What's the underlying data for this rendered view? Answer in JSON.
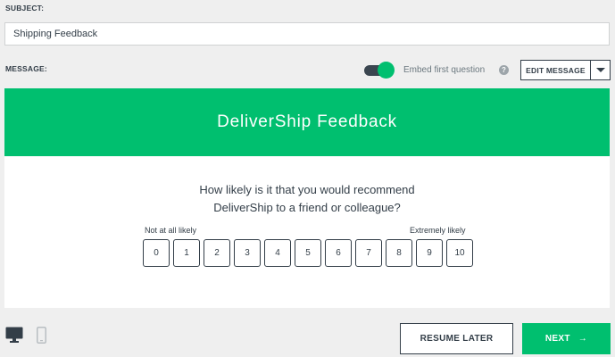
{
  "subject": {
    "label": "SUBJECT:",
    "value": "Shipping Feedback"
  },
  "message": {
    "label": "MESSAGE:",
    "embed_label": "Embed first question",
    "embed_enabled": true,
    "help_icon": "?",
    "edit_label": "EDIT MESSAGE"
  },
  "preview": {
    "banner_title": "DeliverShip Feedback",
    "question_line1": "How likely is it that you would recommend",
    "question_line2": "DeliverShip to a friend or colleague?",
    "low_label": "Not at all likely",
    "high_label": "Extremely likely",
    "scale": [
      "0",
      "1",
      "2",
      "3",
      "4",
      "5",
      "6",
      "7",
      "8",
      "9",
      "10"
    ]
  },
  "footer": {
    "resume_label": "RESUME LATER",
    "next_label": "NEXT",
    "next_icon": "→"
  },
  "colors": {
    "accent": "#00bf6f",
    "text": "#333e48",
    "background": "#efefef"
  },
  "icons": {
    "desktop": "desktop-icon",
    "mobile": "mobile-icon",
    "help": "help-icon",
    "caret": "chevron-down-icon",
    "next": "arrow-right-icon"
  }
}
